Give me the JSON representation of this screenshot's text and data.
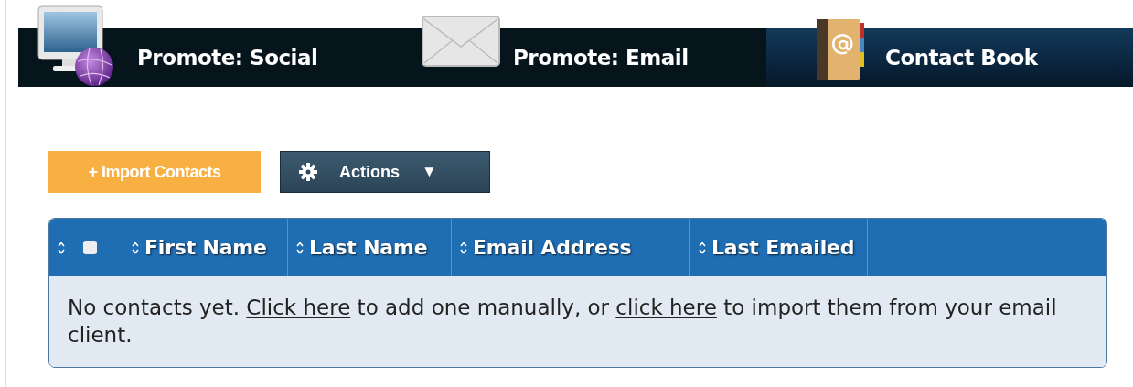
{
  "tabs": [
    {
      "label": "Promote: Social",
      "selected": false
    },
    {
      "label": "Promote: Email",
      "selected": false
    },
    {
      "label": "Contact Book",
      "selected": true
    }
  ],
  "toolbar": {
    "import_button": "+ Import Contacts",
    "actions_button": "Actions",
    "actions_caret": "▼"
  },
  "table": {
    "select_all": {
      "checked": false
    },
    "columns": [
      "First Name",
      "Last Name",
      "Email Address",
      "Last Emailed"
    ],
    "empty_message": {
      "before": "No contacts yet. ",
      "link_1": "Click here",
      "middle": " to add one manually, or ",
      "link_2": "click here",
      "after": " to import them from your email client."
    }
  }
}
